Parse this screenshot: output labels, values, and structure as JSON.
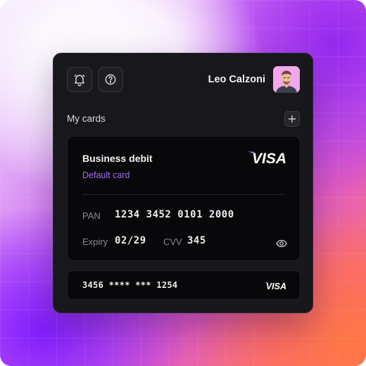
{
  "header": {
    "user_name": "Leo Calzoni",
    "icons": [
      "bell-icon",
      "help-icon"
    ]
  },
  "cards_section": {
    "title": "My cards",
    "add_icon": "plus-icon"
  },
  "primary_card": {
    "name": "Business debit",
    "subtitle": "Default card",
    "brand": "VISA",
    "pan_label": "PAN",
    "pan_value": "1234 3452 0101 2000",
    "expiry_label": "Expiry",
    "expiry_value": "02/29",
    "cvv_label": "CVV",
    "cvv_value": "345",
    "reveal_icon": "eye-icon"
  },
  "secondary_card": {
    "masked_number": "3456 **** *** 1254",
    "brand": "VISA"
  },
  "colors": {
    "accent": "#a36cf5",
    "panel": "#18171c",
    "card": "#08080a",
    "visa_accent": "#a36cf5"
  }
}
